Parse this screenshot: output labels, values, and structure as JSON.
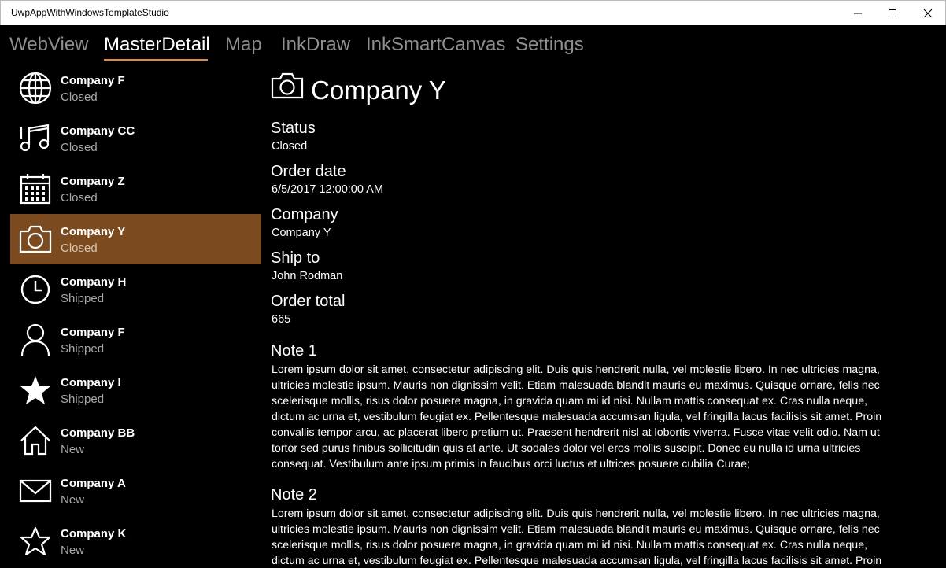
{
  "window": {
    "title": "UwpAppWithWindowsTemplateStudio",
    "minimize_icon": "minimize-icon",
    "maximize_icon": "maximize-icon",
    "close_icon": "close-icon"
  },
  "tabs": [
    {
      "label": "WebView",
      "active": false
    },
    {
      "label": "MasterDetail",
      "active": true
    },
    {
      "label": "Map",
      "active": false
    },
    {
      "label": "InkDraw",
      "active": false
    },
    {
      "label": "InkSmartCanvas",
      "active": false
    },
    {
      "label": "Settings",
      "active": false
    }
  ],
  "colors": {
    "accent": "#e3883a",
    "selected_background": "#7b4a1e",
    "inactive_tab": "#8f8f8f"
  },
  "master": {
    "items": [
      {
        "name": "Company F",
        "status": "Closed",
        "icon": "globe-icon",
        "selected": false
      },
      {
        "name": "Company CC",
        "status": "Closed",
        "icon": "music-note-icon",
        "selected": false
      },
      {
        "name": "Company Z",
        "status": "Closed",
        "icon": "calendar-icon",
        "selected": false
      },
      {
        "name": "Company Y",
        "status": "Closed",
        "icon": "camera-icon",
        "selected": true
      },
      {
        "name": "Company H",
        "status": "Shipped",
        "icon": "clock-icon",
        "selected": false
      },
      {
        "name": "Company F",
        "status": "Shipped",
        "icon": "person-icon",
        "selected": false
      },
      {
        "name": "Company I",
        "status": "Shipped",
        "icon": "star-filled-icon",
        "selected": false
      },
      {
        "name": "Company BB",
        "status": "New",
        "icon": "home-icon",
        "selected": false
      },
      {
        "name": "Company A",
        "status": "New",
        "icon": "mail-icon",
        "selected": false
      },
      {
        "name": "Company K",
        "status": "New",
        "icon": "star-outline-icon",
        "selected": false
      }
    ]
  },
  "detail": {
    "title": "Company Y",
    "icon": "camera-icon",
    "fields": [
      {
        "label": "Status",
        "value": "Closed"
      },
      {
        "label": "Order date",
        "value": "6/5/2017 12:00:00 AM"
      },
      {
        "label": "Company",
        "value": "Company Y"
      },
      {
        "label": "Ship to",
        "value": "John Rodman"
      },
      {
        "label": "Order total",
        "value": "665"
      }
    ],
    "notes": [
      {
        "title": "Note 1",
        "lines": [
          "Lorem ipsum dolor sit amet, consectetur adipiscing elit. Duis quis hendrerit nulla, vel molestie libero. In nec ultricies magna,",
          "ultricies molestie ipsum. Mauris non dignissim velit. Etiam malesuada blandit mauris eu maximus. Quisque ornare, felis nec",
          "scelerisque mollis, risus dolor posuere magna, in gravida quam mi id nisi. Nullam mattis consequat ex. Cras nulla neque,",
          "dictum ac urna et, vestibulum feugiat ex. Pellentesque malesuada accumsan ligula, vel fringilla lacus facilisis sit amet. Proin",
          "convallis tempor arcu, ac placerat libero pretium ut. Praesent hendrerit nisl at lobortis viverra. Fusce vitae velit odio. Nam ut",
          "tortor sed purus finibus sollicitudin quis at ante. Ut sodales dolor vel eros mollis suscipit. Donec eu nulla id urna ultricies",
          "consequat. Vestibulum ante ipsum primis in faucibus orci luctus et ultrices posuere cubilia Curae;"
        ]
      },
      {
        "title": "Note 2",
        "lines": [
          "Lorem ipsum dolor sit amet, consectetur adipiscing elit. Duis quis hendrerit nulla, vel molestie libero. In nec ultricies magna,",
          "ultricies molestie ipsum. Mauris non dignissim velit. Etiam malesuada blandit mauris eu maximus. Quisque ornare, felis nec",
          "scelerisque mollis, risus dolor posuere magna, in gravida quam mi id nisi. Nullam mattis consequat ex. Cras nulla neque,",
          "dictum ac urna et, vestibulum feugiat ex. Pellentesque malesuada accumsan ligula, vel fringilla lacus facilisis sit amet. Proin"
        ]
      }
    ]
  }
}
